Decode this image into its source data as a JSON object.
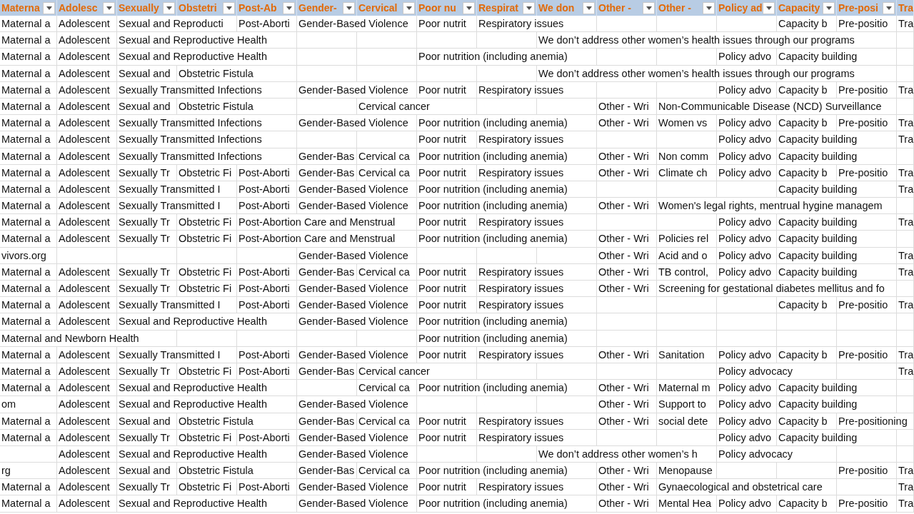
{
  "columns": [
    {
      "label": "Materna",
      "filter": true
    },
    {
      "label": "Adolesc",
      "filter": true
    },
    {
      "label": "Sexually",
      "filter": true
    },
    {
      "label": "Obstetri",
      "filter": true
    },
    {
      "label": "Post-Ab",
      "filter": true
    },
    {
      "label": "Gender-",
      "filter": true
    },
    {
      "label": "Cervical",
      "filter": true
    },
    {
      "label": "Poor nu",
      "filter": true
    },
    {
      "label": "Respirat",
      "filter": true
    },
    {
      "label": "We don",
      "filter": true
    },
    {
      "label": "Other -",
      "filter": true
    },
    {
      "label": "Other -",
      "filter": true
    },
    {
      "label": "Policy ad",
      "filter": true
    },
    {
      "label": "Capacity",
      "filter": true
    },
    {
      "label": "Pre-posi",
      "filter": true
    },
    {
      "label": "Tra",
      "filter": false
    }
  ],
  "rows": [
    {
      "cells": [
        "Maternal a",
        "Adolescent",
        "Sexual and Reproducti",
        null,
        "Post-Aborti",
        "Gender-Based Violence",
        null,
        "Poor nutrit",
        "Respiratory issues",
        null,
        null,
        null,
        null,
        "Capacity b",
        "Pre-positio",
        "Tra"
      ]
    },
    {
      "cells": [
        "Maternal a",
        "Adolescent",
        "Sexual and Reproductive Health",
        null,
        null,
        null,
        null,
        null,
        null,
        "We don’t address other women’s health issues through our programs",
        null,
        null,
        null,
        null,
        null,
        null
      ]
    },
    {
      "cells": [
        "Maternal a",
        "Adolescent",
        "Sexual and Reproductive Health",
        null,
        null,
        null,
        null,
        "Poor nutrition (including anemia)",
        null,
        null,
        null,
        null,
        "Policy advo",
        "Capacity building",
        null,
        null
      ]
    },
    {
      "cells": [
        "Maternal a",
        "Adolescent",
        "Sexual and",
        "Obstetric Fistula",
        null,
        null,
        null,
        null,
        null,
        "We don’t address other women’s health issues through our programs",
        null,
        null,
        null,
        null,
        null,
        null
      ]
    },
    {
      "cells": [
        "Maternal a",
        "Adolescent",
        "Sexually Transmitted Infections",
        null,
        null,
        "Gender-Based Violence",
        null,
        "Poor nutrit",
        "Respiratory issues",
        null,
        null,
        null,
        "Policy advo",
        "Capacity b",
        "Pre-positio",
        "Tra"
      ]
    },
    {
      "cells": [
        "Maternal a",
        "Adolescent",
        "Sexual and",
        "Obstetric Fistula",
        null,
        null,
        "Cervical cancer",
        null,
        null,
        null,
        "Other - Wri",
        "Non-Communicable Disease (NCD) Surveillance",
        null,
        null,
        null,
        null
      ]
    },
    {
      "cells": [
        "Maternal a",
        "Adolescent",
        "Sexually Transmitted Infections",
        null,
        null,
        "Gender-Based Violence",
        null,
        "Poor nutrition (including anemia)",
        null,
        null,
        "Other - Wri",
        "Women vs",
        "Policy advo",
        "Capacity b",
        "Pre-positio",
        "Tra"
      ]
    },
    {
      "cells": [
        "Maternal a",
        "Adolescent",
        "Sexually Transmitted Infections",
        null,
        null,
        null,
        null,
        "Poor nutrit",
        "Respiratory issues",
        null,
        null,
        null,
        "Policy advo",
        "Capacity building",
        null,
        "Tra"
      ]
    },
    {
      "cells": [
        "Maternal a",
        "Adolescent",
        "Sexually Transmitted Infections",
        null,
        null,
        "Gender-Bas",
        "Cervical ca",
        "Poor nutrition (including anemia)",
        null,
        null,
        "Other - Wri",
        "Non comm",
        "Policy advo",
        "Capacity building",
        null,
        null
      ]
    },
    {
      "cells": [
        "Maternal a",
        "Adolescent",
        "Sexually Tr",
        "Obstetric Fi",
        "Post-Aborti",
        "Gender-Bas",
        "Cervical ca",
        "Poor nutrit",
        "Respiratory issues",
        null,
        "Other - Wri",
        "Climate ch",
        "Policy advo",
        "Capacity b",
        "Pre-positio",
        "Tra"
      ]
    },
    {
      "cells": [
        "Maternal a",
        "Adolescent",
        "Sexually Transmitted I",
        null,
        "Post-Aborti",
        "Gender-Based Violence",
        null,
        "Poor nutrition (including anemia)",
        null,
        null,
        null,
        null,
        null,
        "Capacity building",
        null,
        "Tra"
      ]
    },
    {
      "cells": [
        "Maternal a",
        "Adolescent",
        "Sexually Transmitted I",
        null,
        "Post-Aborti",
        "Gender-Based Violence",
        null,
        "Poor nutrition (including anemia)",
        null,
        null,
        "Other - Wri",
        "Women's legal rights, mentrual hygine managem",
        null,
        null,
        null,
        null
      ]
    },
    {
      "cells": [
        "Maternal a",
        "Adolescent",
        "Sexually Tr",
        "Obstetric Fi",
        "Post-Abortion Care and Menstrual",
        null,
        null,
        "Poor nutrit",
        "Respiratory issues",
        null,
        null,
        null,
        "Policy advo",
        "Capacity building",
        null,
        "Tra"
      ]
    },
    {
      "cells": [
        "Maternal a",
        "Adolescent",
        "Sexually Tr",
        "Obstetric Fi",
        "Post-Abortion Care and Menstrual",
        null,
        null,
        "Poor nutrition (including anemia)",
        null,
        null,
        "Other - Wri",
        "Policies rel",
        "Policy advo",
        "Capacity building",
        null,
        null
      ]
    },
    {
      "cells": [
        "vivors.org",
        null,
        null,
        null,
        null,
        "Gender-Based Violence",
        null,
        null,
        null,
        null,
        "Other - Wri",
        "Acid and o",
        "Policy advo",
        "Capacity building",
        null,
        "Tra"
      ]
    },
    {
      "cells": [
        "Maternal a",
        "Adolescent",
        "Sexually Tr",
        "Obstetric Fi",
        "Post-Aborti",
        "Gender-Bas",
        "Cervical ca",
        "Poor nutrit",
        "Respiratory issues",
        null,
        "Other - Wri",
        "TB control,",
        "Policy advo",
        "Capacity building",
        null,
        "Tra"
      ]
    },
    {
      "cells": [
        "Maternal a",
        "Adolescent",
        "Sexually Tr",
        "Obstetric Fi",
        "Post-Aborti",
        "Gender-Based Violence",
        null,
        "Poor nutrit",
        "Respiratory issues",
        null,
        "Other - Wri",
        "Screening for gestational diabetes mellitus and fo",
        null,
        null,
        null,
        null
      ]
    },
    {
      "cells": [
        "Maternal a",
        "Adolescent",
        "Sexually Transmitted I",
        null,
        "Post-Aborti",
        "Gender-Based Violence",
        null,
        "Poor nutrit",
        "Respiratory issues",
        null,
        null,
        null,
        null,
        "Capacity b",
        "Pre-positio",
        "Tra"
      ]
    },
    {
      "cells": [
        "Maternal a",
        "Adolescent",
        "Sexual and Reproductive Health",
        null,
        null,
        "Gender-Based Violence",
        null,
        "Poor nutrition (including anemia)",
        null,
        null,
        null,
        null,
        null,
        null,
        null,
        null
      ]
    },
    {
      "cells": [
        "Maternal and Newborn Health",
        null,
        null,
        null,
        null,
        null,
        null,
        "Poor nutrition (including anemia)",
        null,
        null,
        null,
        null,
        null,
        null,
        null,
        null
      ]
    },
    {
      "cells": [
        "Maternal a",
        "Adolescent",
        "Sexually Transmitted I",
        null,
        "Post-Aborti",
        "Gender-Based Violence",
        null,
        "Poor nutrit",
        "Respiratory issues",
        null,
        "Other - Wri",
        "Sanitation",
        "Policy advo",
        "Capacity b",
        "Pre-positio",
        "Tra"
      ]
    },
    {
      "cells": [
        "Maternal a",
        "Adolescent",
        "Sexually Tr",
        "Obstetric Fi",
        "Post-Aborti",
        "Gender-Bas",
        "Cervical cancer",
        null,
        null,
        null,
        null,
        null,
        "Policy advocacy",
        null,
        null,
        "Tra"
      ]
    },
    {
      "cells": [
        "Maternal a",
        "Adolescent",
        "Sexual and Reproductive Health",
        null,
        null,
        null,
        "Cervical ca",
        "Poor nutrition (including anemia)",
        null,
        null,
        "Other - Wri",
        "Maternal m",
        "Policy advo",
        "Capacity building",
        null,
        null
      ]
    },
    {
      "cells": [
        "om",
        "Adolescent",
        "Sexual and Reproductive Health",
        null,
        null,
        "Gender-Based Violence",
        null,
        null,
        null,
        null,
        "Other - Wri",
        "Support to",
        "Policy advo",
        "Capacity building",
        null,
        null
      ]
    },
    {
      "cells": [
        "Maternal a",
        "Adolescent",
        "Sexual and",
        "Obstetric Fistula",
        null,
        "Gender-Bas",
        "Cervical ca",
        "Poor nutrit",
        "Respiratory issues",
        null,
        "Other - Wri",
        "social dete",
        "Policy advo",
        "Capacity b",
        "Pre-positioning",
        null
      ]
    },
    {
      "cells": [
        "Maternal a",
        "Adolescent",
        "Sexually Tr",
        "Obstetric Fi",
        "Post-Aborti",
        "Gender-Based Violence",
        null,
        "Poor nutrit",
        "Respiratory issues",
        null,
        null,
        null,
        "Policy advo",
        "Capacity building",
        null,
        null
      ]
    },
    {
      "cells": [
        null,
        "Adolescent",
        "Sexual and Reproductive Health",
        null,
        null,
        "Gender-Based Violence",
        null,
        null,
        null,
        "We don’t address other women’s h",
        null,
        null,
        "Policy advocacy",
        null,
        null,
        null
      ]
    },
    {
      "cells": [
        "rg",
        "Adolescent",
        "Sexual and",
        "Obstetric Fistula",
        null,
        "Gender-Bas",
        "Cervical ca",
        "Poor nutrition (including anemia)",
        null,
        null,
        "Other - Wri",
        "Menopause",
        null,
        null,
        "Pre-positio",
        "Tra"
      ]
    },
    {
      "cells": [
        "Maternal a",
        "Adolescent",
        "Sexually Tr",
        "Obstetric Fi",
        "Post-Aborti",
        "Gender-Based Violence",
        null,
        "Poor nutrit",
        "Respiratory issues",
        null,
        "Other - Wri",
        "Gynaecological and obstetrical care",
        null,
        null,
        null,
        "Tra"
      ]
    },
    {
      "cells": [
        "Maternal a",
        "Adolescent",
        "Sexual and Reproductive Health",
        null,
        null,
        "Gender-Based Violence",
        null,
        "Poor nutrition (including anemia)",
        null,
        null,
        "Other - Wri",
        "Mental Hea",
        "Policy advo",
        "Capacity b",
        "Pre-positio",
        "Tra"
      ]
    }
  ]
}
